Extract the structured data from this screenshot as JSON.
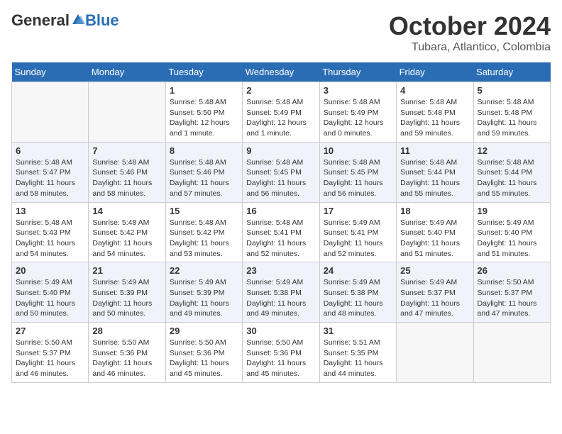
{
  "header": {
    "logo_general": "General",
    "logo_blue": "Blue",
    "month_title": "October 2024",
    "location": "Tubara, Atlantico, Colombia"
  },
  "days_of_week": [
    "Sunday",
    "Monday",
    "Tuesday",
    "Wednesday",
    "Thursday",
    "Friday",
    "Saturday"
  ],
  "weeks": [
    [
      {
        "day": "",
        "sunrise": "",
        "sunset": "",
        "daylight": ""
      },
      {
        "day": "",
        "sunrise": "",
        "sunset": "",
        "daylight": ""
      },
      {
        "day": "1",
        "sunrise": "Sunrise: 5:48 AM",
        "sunset": "Sunset: 5:50 PM",
        "daylight": "Daylight: 12 hours and 1 minute."
      },
      {
        "day": "2",
        "sunrise": "Sunrise: 5:48 AM",
        "sunset": "Sunset: 5:49 PM",
        "daylight": "Daylight: 12 hours and 1 minute."
      },
      {
        "day": "3",
        "sunrise": "Sunrise: 5:48 AM",
        "sunset": "Sunset: 5:49 PM",
        "daylight": "Daylight: 12 hours and 0 minutes."
      },
      {
        "day": "4",
        "sunrise": "Sunrise: 5:48 AM",
        "sunset": "Sunset: 5:48 PM",
        "daylight": "Daylight: 11 hours and 59 minutes."
      },
      {
        "day": "5",
        "sunrise": "Sunrise: 5:48 AM",
        "sunset": "Sunset: 5:48 PM",
        "daylight": "Daylight: 11 hours and 59 minutes."
      }
    ],
    [
      {
        "day": "6",
        "sunrise": "Sunrise: 5:48 AM",
        "sunset": "Sunset: 5:47 PM",
        "daylight": "Daylight: 11 hours and 58 minutes."
      },
      {
        "day": "7",
        "sunrise": "Sunrise: 5:48 AM",
        "sunset": "Sunset: 5:46 PM",
        "daylight": "Daylight: 11 hours and 58 minutes."
      },
      {
        "day": "8",
        "sunrise": "Sunrise: 5:48 AM",
        "sunset": "Sunset: 5:46 PM",
        "daylight": "Daylight: 11 hours and 57 minutes."
      },
      {
        "day": "9",
        "sunrise": "Sunrise: 5:48 AM",
        "sunset": "Sunset: 5:45 PM",
        "daylight": "Daylight: 11 hours and 56 minutes."
      },
      {
        "day": "10",
        "sunrise": "Sunrise: 5:48 AM",
        "sunset": "Sunset: 5:45 PM",
        "daylight": "Daylight: 11 hours and 56 minutes."
      },
      {
        "day": "11",
        "sunrise": "Sunrise: 5:48 AM",
        "sunset": "Sunset: 5:44 PM",
        "daylight": "Daylight: 11 hours and 55 minutes."
      },
      {
        "day": "12",
        "sunrise": "Sunrise: 5:48 AM",
        "sunset": "Sunset: 5:44 PM",
        "daylight": "Daylight: 11 hours and 55 minutes."
      }
    ],
    [
      {
        "day": "13",
        "sunrise": "Sunrise: 5:48 AM",
        "sunset": "Sunset: 5:43 PM",
        "daylight": "Daylight: 11 hours and 54 minutes."
      },
      {
        "day": "14",
        "sunrise": "Sunrise: 5:48 AM",
        "sunset": "Sunset: 5:42 PM",
        "daylight": "Daylight: 11 hours and 54 minutes."
      },
      {
        "day": "15",
        "sunrise": "Sunrise: 5:48 AM",
        "sunset": "Sunset: 5:42 PM",
        "daylight": "Daylight: 11 hours and 53 minutes."
      },
      {
        "day": "16",
        "sunrise": "Sunrise: 5:48 AM",
        "sunset": "Sunset: 5:41 PM",
        "daylight": "Daylight: 11 hours and 52 minutes."
      },
      {
        "day": "17",
        "sunrise": "Sunrise: 5:49 AM",
        "sunset": "Sunset: 5:41 PM",
        "daylight": "Daylight: 11 hours and 52 minutes."
      },
      {
        "day": "18",
        "sunrise": "Sunrise: 5:49 AM",
        "sunset": "Sunset: 5:40 PM",
        "daylight": "Daylight: 11 hours and 51 minutes."
      },
      {
        "day": "19",
        "sunrise": "Sunrise: 5:49 AM",
        "sunset": "Sunset: 5:40 PM",
        "daylight": "Daylight: 11 hours and 51 minutes."
      }
    ],
    [
      {
        "day": "20",
        "sunrise": "Sunrise: 5:49 AM",
        "sunset": "Sunset: 5:40 PM",
        "daylight": "Daylight: 11 hours and 50 minutes."
      },
      {
        "day": "21",
        "sunrise": "Sunrise: 5:49 AM",
        "sunset": "Sunset: 5:39 PM",
        "daylight": "Daylight: 11 hours and 50 minutes."
      },
      {
        "day": "22",
        "sunrise": "Sunrise: 5:49 AM",
        "sunset": "Sunset: 5:39 PM",
        "daylight": "Daylight: 11 hours and 49 minutes."
      },
      {
        "day": "23",
        "sunrise": "Sunrise: 5:49 AM",
        "sunset": "Sunset: 5:38 PM",
        "daylight": "Daylight: 11 hours and 49 minutes."
      },
      {
        "day": "24",
        "sunrise": "Sunrise: 5:49 AM",
        "sunset": "Sunset: 5:38 PM",
        "daylight": "Daylight: 11 hours and 48 minutes."
      },
      {
        "day": "25",
        "sunrise": "Sunrise: 5:49 AM",
        "sunset": "Sunset: 5:37 PM",
        "daylight": "Daylight: 11 hours and 47 minutes."
      },
      {
        "day": "26",
        "sunrise": "Sunrise: 5:50 AM",
        "sunset": "Sunset: 5:37 PM",
        "daylight": "Daylight: 11 hours and 47 minutes."
      }
    ],
    [
      {
        "day": "27",
        "sunrise": "Sunrise: 5:50 AM",
        "sunset": "Sunset: 5:37 PM",
        "daylight": "Daylight: 11 hours and 46 minutes."
      },
      {
        "day": "28",
        "sunrise": "Sunrise: 5:50 AM",
        "sunset": "Sunset: 5:36 PM",
        "daylight": "Daylight: 11 hours and 46 minutes."
      },
      {
        "day": "29",
        "sunrise": "Sunrise: 5:50 AM",
        "sunset": "Sunset: 5:36 PM",
        "daylight": "Daylight: 11 hours and 45 minutes."
      },
      {
        "day": "30",
        "sunrise": "Sunrise: 5:50 AM",
        "sunset": "Sunset: 5:36 PM",
        "daylight": "Daylight: 11 hours and 45 minutes."
      },
      {
        "day": "31",
        "sunrise": "Sunrise: 5:51 AM",
        "sunset": "Sunset: 5:35 PM",
        "daylight": "Daylight: 11 hours and 44 minutes."
      },
      {
        "day": "",
        "sunrise": "",
        "sunset": "",
        "daylight": ""
      },
      {
        "day": "",
        "sunrise": "",
        "sunset": "",
        "daylight": ""
      }
    ]
  ]
}
